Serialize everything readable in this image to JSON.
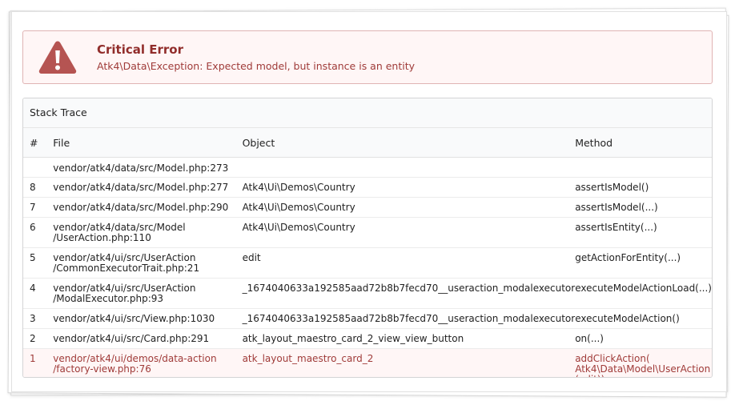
{
  "error": {
    "title": "Critical Error",
    "message": "Atk4\\Data\\Exception: Expected model, but instance is an entity",
    "icon": "warning-triangle-icon",
    "color": "#9f3a38"
  },
  "trace": {
    "heading": "Stack Trace",
    "columns": {
      "num": "#",
      "file": "File",
      "object": "Object",
      "method": "Method"
    },
    "rows": [
      {
        "num": "",
        "file": [
          "vendor/atk4/data/src/Model.php:273"
        ],
        "object": "",
        "method": [
          ""
        ]
      },
      {
        "num": "8",
        "file": [
          "vendor/atk4/data/src/Model.php:277"
        ],
        "object": "Atk4\\Ui\\Demos\\Country",
        "method": [
          "assertIsModel()"
        ]
      },
      {
        "num": "7",
        "file": [
          "vendor/atk4/data/src/Model.php:290"
        ],
        "object": "Atk4\\Ui\\Demos\\Country",
        "method": [
          "assertIsModel(...)"
        ]
      },
      {
        "num": "6",
        "file": [
          "vendor/atk4/data/src/Model",
          "/UserAction.php:110"
        ],
        "object": "Atk4\\Ui\\Demos\\Country",
        "method": [
          "assertIsEntity(...)"
        ]
      },
      {
        "num": "5",
        "file": [
          "vendor/atk4/ui/src/UserAction",
          "/CommonExecutorTrait.php:21"
        ],
        "object": "edit",
        "method": [
          "getActionForEntity(...)"
        ]
      },
      {
        "num": "4",
        "file": [
          "vendor/atk4/ui/src/UserAction",
          "/ModalExecutor.php:93"
        ],
        "object": "_1674040633a192585aad72b8b7fecd70__useraction_modalexecutor",
        "method": [
          "executeModelActionLoad(...)"
        ]
      },
      {
        "num": "3",
        "file": [
          "vendor/atk4/ui/src/View.php:1030"
        ],
        "object": "_1674040633a192585aad72b8b7fecd70__useraction_modalexecutor",
        "method": [
          "executeModelAction()"
        ]
      },
      {
        "num": "2",
        "file": [
          "vendor/atk4/ui/src/Card.php:291"
        ],
        "object": "atk_layout_maestro_card_2_view_view_button",
        "method": [
          "on(...)"
        ]
      },
      {
        "num": "1",
        "file": [
          "vendor/atk4/ui/demos/data-action",
          "/factory-view.php:76"
        ],
        "object": "atk_layout_maestro_card_2",
        "method": [
          "addClickAction(",
          "Atk4\\Data\\Model\\UserAction",
          "(edit))"
        ]
      }
    ]
  }
}
